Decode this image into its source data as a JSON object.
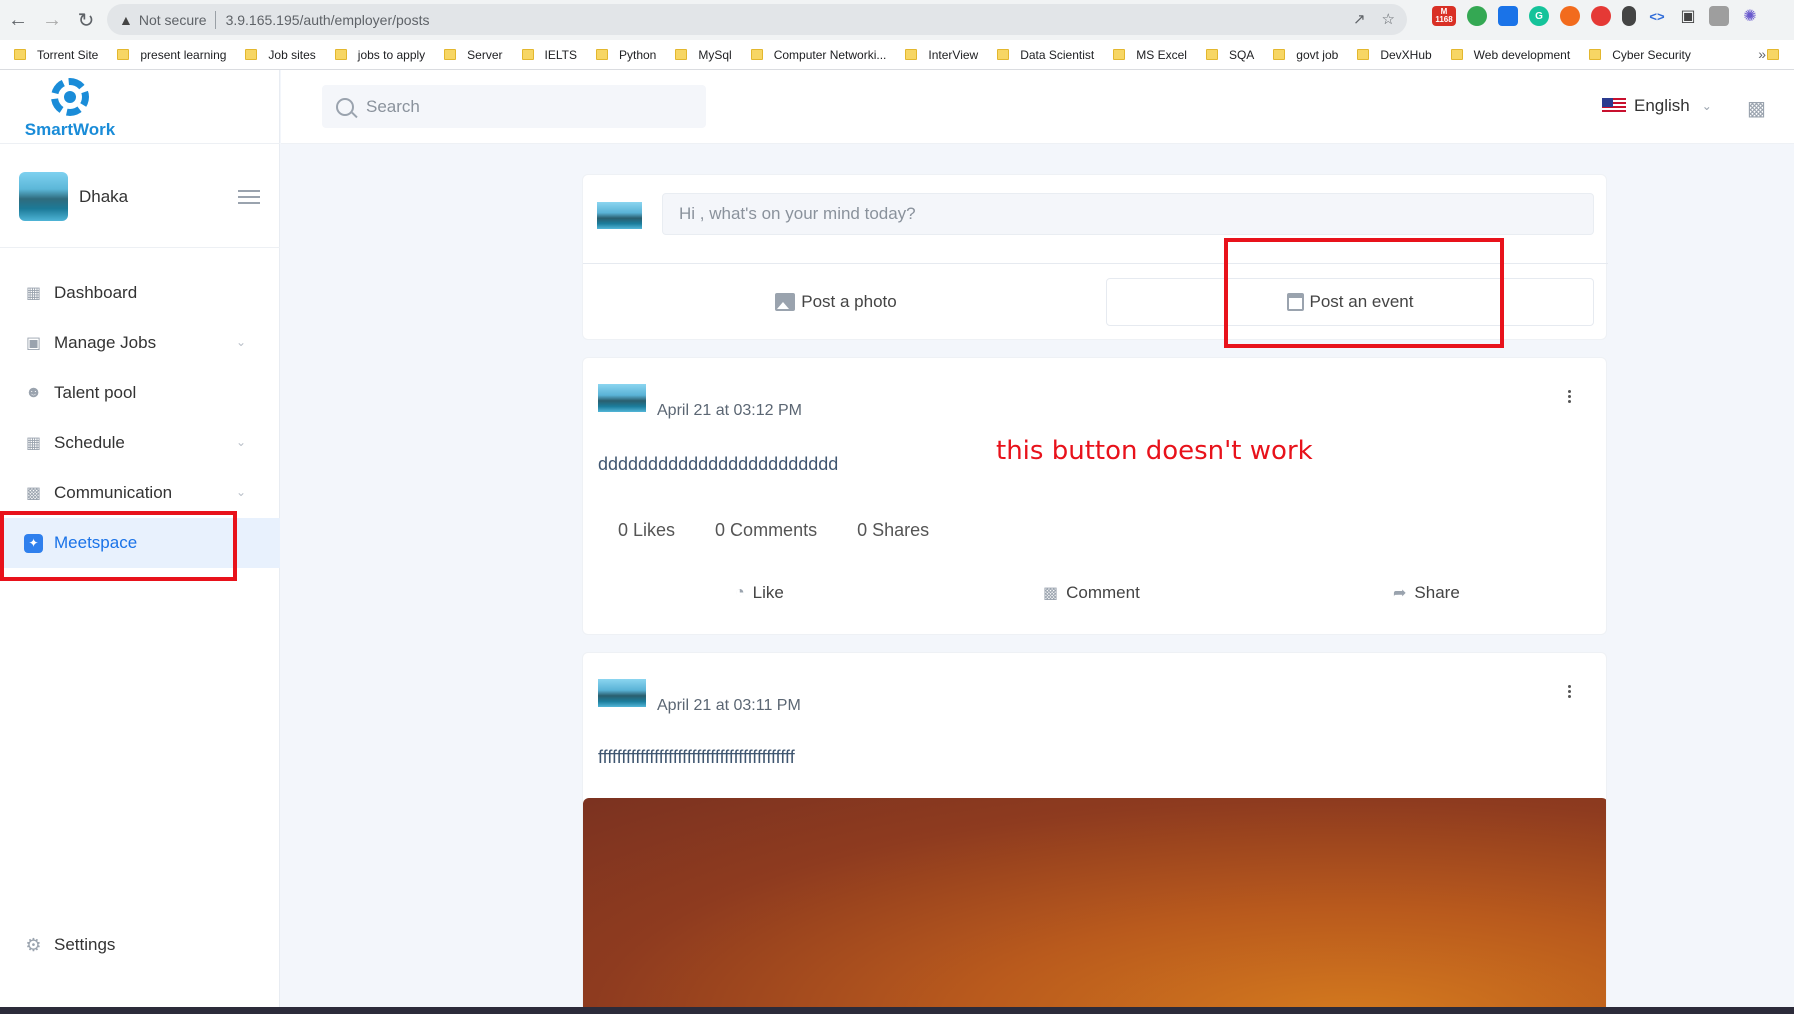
{
  "browser": {
    "security_label": "Not secure",
    "url": "3.9.165.195/auth/employer/posts",
    "gmail_count": "1168",
    "bookmarks": [
      "Torrent Site",
      "present learning",
      "Job sites",
      "jobs to apply",
      "Server",
      "IELTS",
      "Python",
      "MySql",
      "Computer Networki...",
      "InterView",
      "Data Scientist",
      "MS Excel",
      "SQA",
      "govt job",
      "DevXHub",
      "Web development",
      "Cyber Security"
    ],
    "bookmarks_more": "»"
  },
  "app": {
    "logo_text": "SmartWork",
    "brand_color": "#1a8cd8",
    "profile_name": "Dhaka",
    "nav": [
      {
        "label": "Dashboard",
        "icon": "dashboard-icon",
        "expandable": false
      },
      {
        "label": "Manage Jobs",
        "icon": "briefcase-icon",
        "expandable": true
      },
      {
        "label": "Talent pool",
        "icon": "user-search-icon",
        "expandable": false
      },
      {
        "label": "Schedule",
        "icon": "calendar-icon",
        "expandable": true
      },
      {
        "label": "Communication",
        "icon": "chat-icon",
        "expandable": true
      },
      {
        "label": "Meetspace",
        "icon": "sparkle-icon",
        "expandable": false,
        "active": true
      }
    ],
    "settings_label": "Settings"
  },
  "topbar": {
    "search_placeholder": "Search",
    "language": "English"
  },
  "composer": {
    "placeholder": "Hi , what's on your mind today?",
    "post_photo": "Post a photo",
    "post_event": "Post an event"
  },
  "posts": [
    {
      "time": "April 21 at 03:12 PM",
      "text": "dddddddddddddddddddddddd",
      "likes": "0 Likes",
      "comments": "0 Comments",
      "shares": "0 Shares",
      "like_action": "Like",
      "comment_action": "Comment",
      "share_action": "Share"
    },
    {
      "time": "April 21 at 03:11 PM",
      "text": "ffffffffffffffffffffffffffffffffffffffffff"
    }
  ],
  "annotation": {
    "note": "this button doesn't work",
    "color": "#e8121b"
  }
}
